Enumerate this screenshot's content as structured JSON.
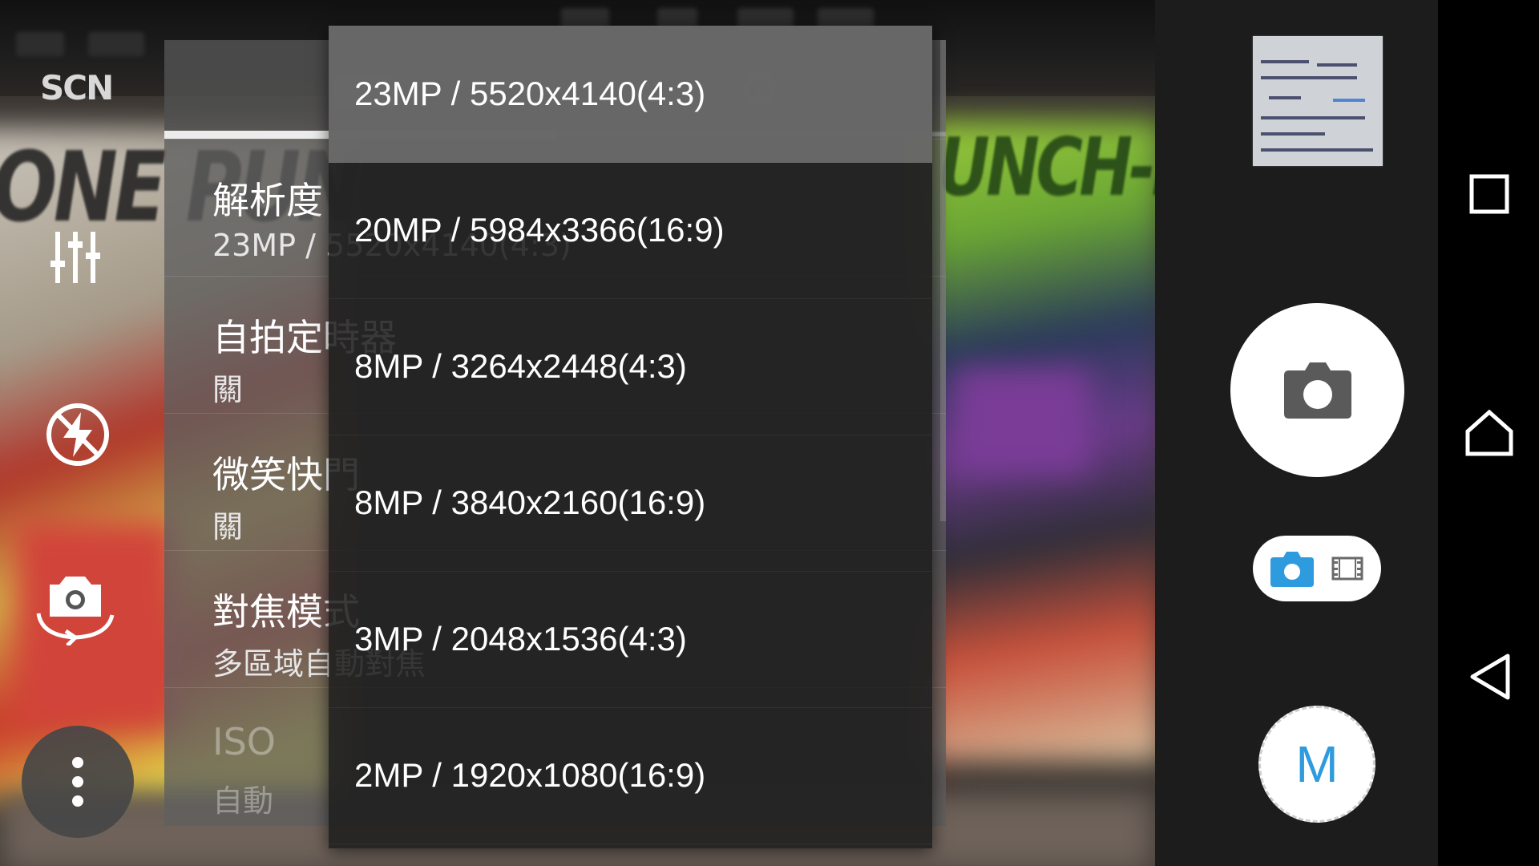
{
  "camera": {
    "scene_mode_label": "SCN",
    "manual_mode_label": "M",
    "modes": [
      "photo-mode-icon",
      "video-mode-icon"
    ],
    "active_mode": "photo"
  },
  "settings": {
    "rows": [
      {
        "title": "解析度",
        "value": "23MP / 5520x4140(4:3)",
        "enabled": true
      },
      {
        "title": "自拍定時器",
        "value": "關",
        "enabled": true
      },
      {
        "title": "微笑快門",
        "value": "關",
        "enabled": true
      },
      {
        "title": "對焦模式",
        "value": "多區域自動對焦",
        "enabled": true
      },
      {
        "title": "ISO",
        "value": "自動",
        "enabled": false
      }
    ]
  },
  "resolution_menu": {
    "selected_index": 0,
    "options": [
      "23MP / 5520x4140(4:3)",
      "20MP / 5984x3366(16:9)",
      "8MP / 3264x2448(4:3)",
      "8MP / 3840x2160(16:9)",
      "3MP / 2048x1536(4:3)",
      "2MP / 1920x1080(16:9)"
    ]
  },
  "viewfinder": {
    "background_text_left": "ONE PUNCH",
    "background_text_right": "UNCH-MAN"
  },
  "colors": {
    "accent_blue": "#2f9bdf",
    "panel_gray": "#5f5f5f",
    "menu_dark": "#1e1e1e",
    "selected_row": "#6e6e6e"
  },
  "icons": {
    "left_column": [
      "scn-icon",
      "adjust-icon",
      "flash-off-icon",
      "switch-camera-icon",
      "more-options-icon"
    ],
    "nav": [
      "recents-icon",
      "home-icon",
      "back-icon"
    ]
  }
}
